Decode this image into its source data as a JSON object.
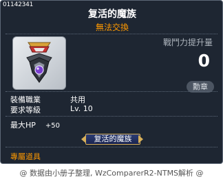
{
  "tooltip": {
    "item_id": "01142341",
    "item_name": "复活的魔族",
    "trade_status": "無法交換",
    "power_label": "戰鬥力提升量",
    "power_value": "0",
    "medal_button": "勳章",
    "attributes": [
      {
        "label": "裝備職業",
        "value": "共用"
      },
      {
        "label": "要求等級",
        "value": "Lv. 10"
      }
    ],
    "stat": {
      "label": "最大HP",
      "value": "+50"
    },
    "set_name": "复活的魔族",
    "exclusive": "專屬道具"
  },
  "footer": "@ 数据由小册子整理, WzComparerR2-NTMS解析 @",
  "colors": {
    "panel_bg": "#1e2632",
    "trade_status": "#ff9900",
    "exclusive": "#ff9900",
    "set_plate_border": "#d8b05a"
  },
  "icons": {
    "item_image": "medal-icon"
  }
}
